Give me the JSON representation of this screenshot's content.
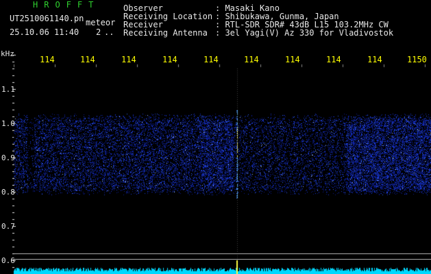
{
  "app": {
    "title": "HROFFT"
  },
  "file": {
    "name": "UT2510061140.pn",
    "type": "meteor",
    "date_time": "25.10.06 11:40",
    "index": "2",
    "ellipsis": ".."
  },
  "info": {
    "labels": [
      "Observer",
      "Receiving Location",
      "Receiver",
      "Receiving Antenna"
    ],
    "values": [
      ": Masaki Kano",
      ": Shibukawa, Gunma, Japan",
      ": RTL-SDR SDR# 43dB L15 103.2MHz CW",
      ": 3el Yagi(V) Az 330 for Vladivostok"
    ]
  },
  "y_axis": {
    "unit": "kHz",
    "ticks": [
      "1.1",
      "1.0",
      "0.9",
      "0.8",
      "0.7",
      "0.6"
    ]
  },
  "x_axis": {
    "ticks": [
      "114",
      "114",
      "114",
      "114",
      "114",
      "114",
      "114",
      "114",
      "114",
      "1150"
    ]
  },
  "colors": {
    "background": "#000000",
    "title": "#2fd02f",
    "text": "#e8e8e8",
    "x_ticks": "#ffff00",
    "noise": "#2040ff",
    "baseline": "#00e0ff"
  }
}
